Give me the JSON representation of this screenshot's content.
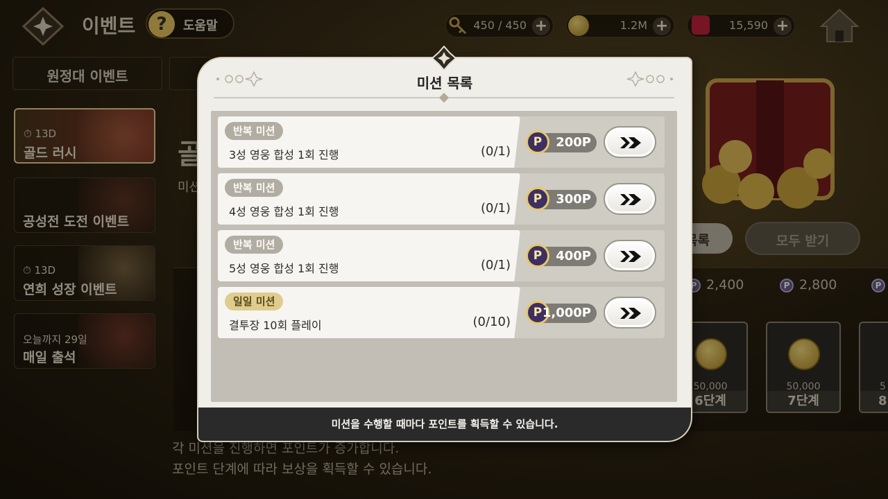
{
  "header": {
    "title": "이벤트",
    "help_label": "도움말",
    "resources": [
      {
        "name": "key",
        "value": "450 / 450"
      },
      {
        "name": "gold",
        "value": "1.2M"
      },
      {
        "name": "gem",
        "value": "15,590"
      }
    ]
  },
  "sidebar": {
    "tab_label": "원정대 이벤트",
    "items": [
      {
        "timer": "13D",
        "title": "골드 러시"
      },
      {
        "title": "공성전 도전 이벤트"
      },
      {
        "timer": "13D",
        "title": "연희 성장 이벤트"
      },
      {
        "sub": "오늘까지 29일",
        "title": "매일 출석"
      }
    ]
  },
  "background": {
    "heading": "골",
    "sub": "미션",
    "mission_list_btn": "목록",
    "claim_all_btn": "모두 받기",
    "points": [
      "2,400",
      "2,800"
    ],
    "stages": [
      {
        "amount": "50,000",
        "label": "6단계"
      },
      {
        "amount": "50,000",
        "label": "7단계"
      },
      {
        "amount": "5",
        "label": "8"
      }
    ],
    "desc_line1": "각 미션을 진행하면 포인트가 증가합니다.",
    "desc_line2": "포인트 단계에 따라 보상을 획득할 수 있습니다."
  },
  "modal": {
    "title": "미션 목록",
    "footer": "미션을 수행할 때마다 포인트를 획득할 수 있습니다.",
    "missions": [
      {
        "tag": "반복 미션",
        "desc": "3성 영웅 합성 1회 진행",
        "progress": "(0/1)",
        "reward": "200P"
      },
      {
        "tag": "반복 미션",
        "desc": "4성 영웅 합성 1회 진행",
        "progress": "(0/1)",
        "reward": "300P"
      },
      {
        "tag": "반복 미션",
        "desc": "5성 영웅 합성 1회 진행",
        "progress": "(0/1)",
        "reward": "400P"
      },
      {
        "tag": "일일 미션",
        "desc": "결투장 10회 플레이",
        "progress": "(0/10)",
        "reward": "1,000P"
      }
    ]
  },
  "icons": {
    "point_letter": "P",
    "help_glyph": "?",
    "plus_glyph": "+"
  },
  "colors": {
    "modal_bg": "#f0eee9",
    "daily_tag": "#dfcd8e",
    "repeat_tag": "#b2ada2",
    "point_coin": "#3e2f62"
  }
}
